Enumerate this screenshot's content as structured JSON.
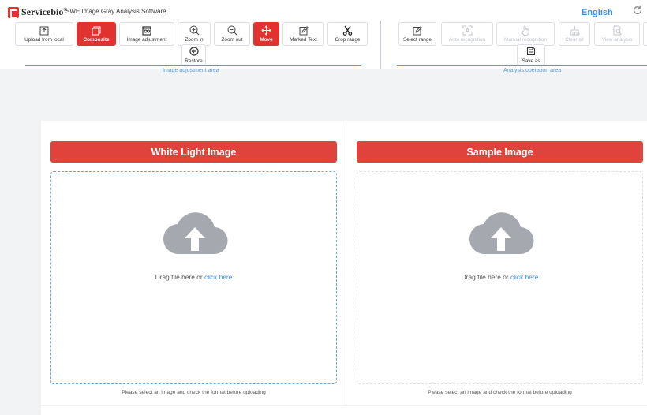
{
  "header": {
    "logo_text": "Servicebio",
    "logo_sup": "®",
    "app_title": "SWE Image Gray Analysis Software",
    "language": "English"
  },
  "toolbar": {
    "upload": "Upload from local",
    "composite": "Composite",
    "image_adjustment": "Image adjustment",
    "zoom_in": "Zoom in",
    "zoom_out": "Zoom out",
    "move": "Move",
    "marked_text": "Marked Text",
    "crop_range": "Crop range",
    "restore": "Restore",
    "select_range": "Select range",
    "auto_recognition": "Auto recognition",
    "manual_recognition": "Manual recognition",
    "clear_all": "Clear all",
    "view_analysis": "View analysis",
    "save_as": "Save as",
    "left_area_label": "Image adjustment area",
    "right_area_label": "Analysis operation area"
  },
  "panels": [
    {
      "title": "White Light Image",
      "drop_text": "Drag file here or ",
      "drop_link": "click here",
      "hint": "Please select an image and check the format before uploading"
    },
    {
      "title": "Sample Image",
      "drop_text": "Drag file here or ",
      "drop_link": "click here",
      "hint": "Please select an image and check the format before uploading"
    }
  ],
  "colors": {
    "accent_red": "#e0332f",
    "link_blue": "#3a8ee6",
    "area_blue": "#5b9bd5",
    "cloud_gray": "#a5a8ae"
  }
}
